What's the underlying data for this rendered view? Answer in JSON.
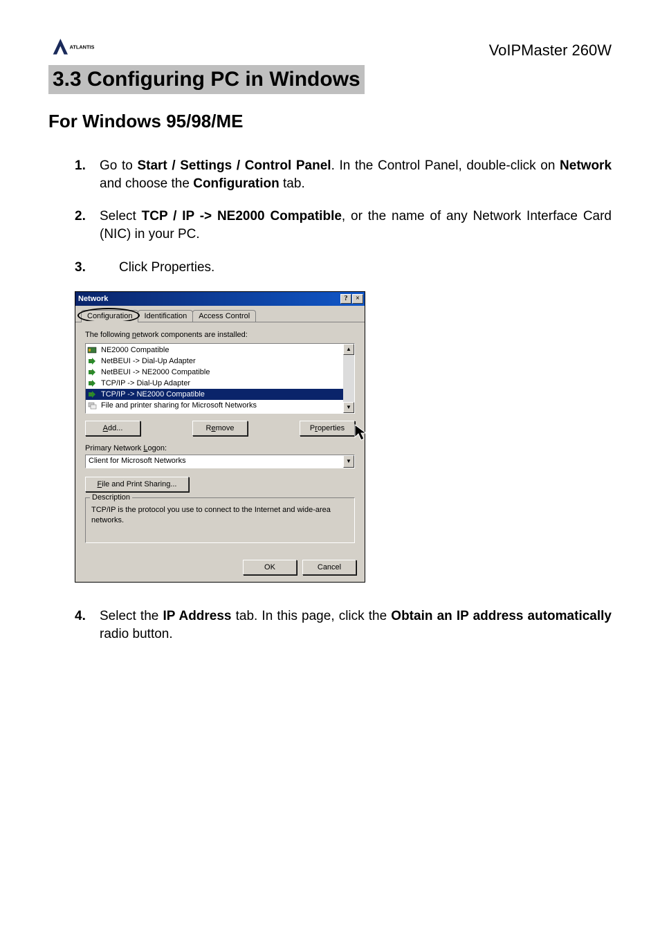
{
  "header": {
    "product_name": "VoIPMaster 260W",
    "logo_text": "ATLANTIS"
  },
  "section": {
    "heading": "3.3 Configuring PC in Windows",
    "subheading": "For Windows 95/98/ME"
  },
  "steps": {
    "s1": {
      "num": "1.",
      "pre": "Go to ",
      "b1": "Start / Settings / Control Panel",
      "mid1": ". In the Control Panel, double-click on ",
      "b2": "Network",
      "mid2": " and choose the ",
      "b3": "Configuration",
      "post": " tab."
    },
    "s2": {
      "num": "2.",
      "pre": "Select ",
      "b1": "TCP / IP -> NE2000 Compatible",
      "post": ", or the name of any Network Interface Card (NIC) in your PC."
    },
    "s3": {
      "num": "3.",
      "text": "Click Properties."
    },
    "s4": {
      "num": "4.",
      "pre": "Select the ",
      "b1": "IP Address",
      "mid1": " tab. In this page, click the ",
      "b2": "Obtain an IP address automatically",
      "post": " radio button."
    }
  },
  "dialog": {
    "title": "Network",
    "help_glyph": "?",
    "close_glyph": "×",
    "tabs": {
      "t1": "Configuration",
      "t2": "Identification",
      "t3": "Access Control"
    },
    "installed_pre": "The following ",
    "installed_u": "n",
    "installed_post": "etwork components are installed:",
    "items": {
      "i0": "NE2000 Compatible",
      "i1": "NetBEUI -> Dial-Up Adapter",
      "i2": "NetBEUI -> NE2000 Compatible",
      "i3": "TCP/IP -> Dial-Up Adapter",
      "i4": "TCP/IP -> NE2000 Compatible",
      "i5": "File and printer sharing for Microsoft Networks"
    },
    "add_u": "A",
    "add_post": "dd...",
    "remove_pre": "R",
    "remove_u": "e",
    "remove_post": "move",
    "props_pre": "P",
    "props_u": "r",
    "props_post": "operties",
    "primary_pre": "Primary Network ",
    "primary_u": "L",
    "primary_post": "ogon:",
    "logon_value": "Client for Microsoft Networks",
    "fps_u": "F",
    "fps_post": "ile and Print Sharing...",
    "group_title": "Description",
    "desc": "TCP/IP is the protocol you use to connect to the Internet and wide-area networks.",
    "ok": "OK",
    "cancel": "Cancel",
    "up_glyph": "▲",
    "down_glyph": "▼"
  }
}
